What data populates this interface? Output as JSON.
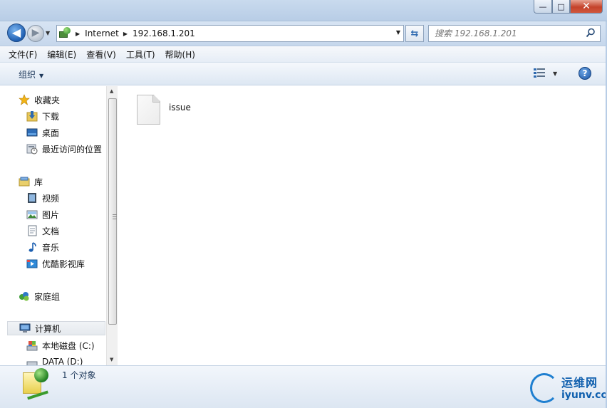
{
  "titlebar": {
    "ghost_tabs": [
      "",
      "",
      ""
    ],
    "min_symbol": "—",
    "max_symbol": "□",
    "close_symbol": "✕"
  },
  "nav": {
    "back_symbol": "◀",
    "forward_symbol": "▶",
    "breadcrumb": [
      "Internet",
      "192.168.1.201"
    ],
    "refresh_symbol": "⇆",
    "search_placeholder": "搜索 192.168.1.201"
  },
  "menubar": {
    "items": [
      "文件(F)",
      "编辑(E)",
      "查看(V)",
      "工具(T)",
      "帮助(H)"
    ]
  },
  "commandbar": {
    "organize_label": "组织",
    "help_symbol": "?"
  },
  "navpane": {
    "favorites_label": "收藏夹",
    "favorites": [
      "下载",
      "桌面",
      "最近访问的位置"
    ],
    "libraries_label": "库",
    "libraries": [
      "视频",
      "图片",
      "文档",
      "音乐",
      "优酷影视库"
    ],
    "homegroup_label": "家庭组",
    "computer_label": "计算机",
    "drives": [
      "本地磁盘 (C:)",
      "DATA (D:)"
    ]
  },
  "content": {
    "files": [
      {
        "name": "issue",
        "icon": "blank-file-icon"
      }
    ]
  },
  "details": {
    "count_text": "1 个对象"
  },
  "watermark": {
    "cn": "运维网",
    "en": "iyunv.com"
  },
  "colors": {
    "accent": "#2f6ab0",
    "frame": "#c6d7ec",
    "close": "#c4432b"
  }
}
